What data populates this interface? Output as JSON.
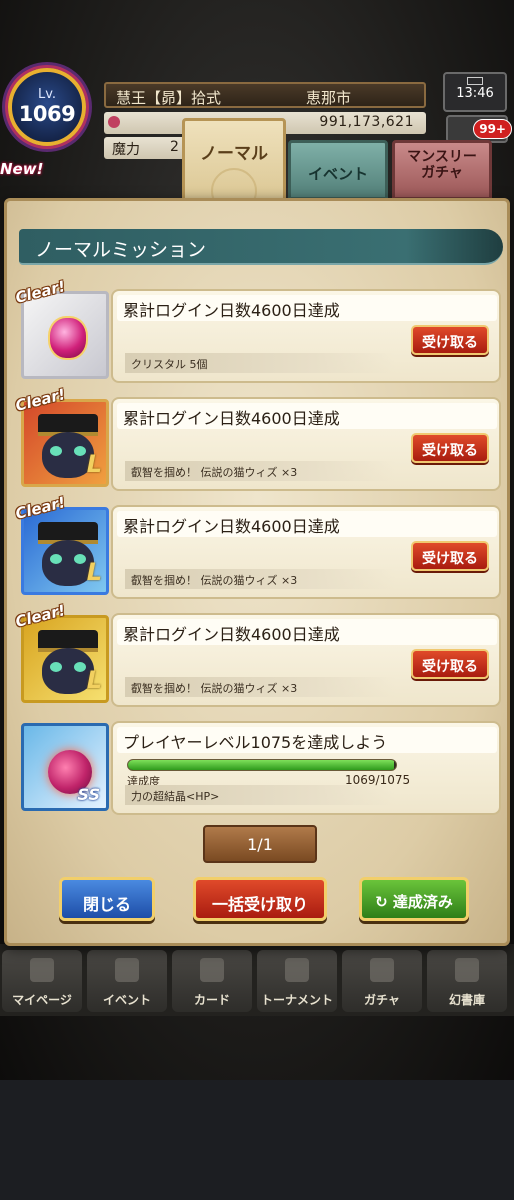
{
  "hud": {
    "level_label": "Lv.",
    "level": "1069",
    "player_name": "慧王【昴】拾式",
    "city": "恵那市",
    "gold": "991,173,621",
    "mp_label": "魔力",
    "mp_value": "2",
    "time": "13:46",
    "notification_count": "99+",
    "new_label": "New!"
  },
  "tabs": {
    "normal": "ノーマル",
    "event": "イベント",
    "monthly_line1": "マンスリー",
    "monthly_line2": "ガチャ"
  },
  "panel": {
    "title": "ノーマルミッション",
    "clear_label": "Clear!",
    "claim_label": "受け取る",
    "missions": [
      {
        "name": "累計ログイン日数4600日達成",
        "reward": "クリスタル 5個"
      },
      {
        "name": "累計ログイン日数4600日達成",
        "reward": "叡智を掴め！ 伝説の猫ウィズ ×3"
      },
      {
        "name": "累計ログイン日数4600日達成",
        "reward": "叡智を掴め！ 伝説の猫ウィズ ×3"
      },
      {
        "name": "累計ログイン日数4600日達成",
        "reward": "叡智を掴め！ 伝説の猫ウィズ ×3"
      },
      {
        "name": "プレイヤーレベル1075を達成しよう",
        "progress_label": "達成度",
        "progress_value": "1069/1075",
        "progress_fraction": 0.994,
        "reward": "力の超結晶<HP>"
      }
    ],
    "pager": "1/1",
    "buttons": {
      "close": "閉じる",
      "bulk_claim": "一括受け取り",
      "completed": "達成済み"
    }
  },
  "nav": [
    {
      "label": "マイページ",
      "icon": "home-icon"
    },
    {
      "label": "イベント",
      "icon": "event-icon"
    },
    {
      "label": "カード",
      "icon": "card-icon"
    },
    {
      "label": "トーナメント",
      "icon": "tournament-icon"
    },
    {
      "label": "ガチャ",
      "icon": "gacha-icon"
    },
    {
      "label": "幻書庫",
      "icon": "library-icon"
    }
  ],
  "colors": {
    "panel_title": "#2f5e62",
    "claim_button": "#c8311c",
    "close_button": "#2e64c4",
    "completed_button": "#3f9a24",
    "progress_fill": "#4fc83a"
  }
}
